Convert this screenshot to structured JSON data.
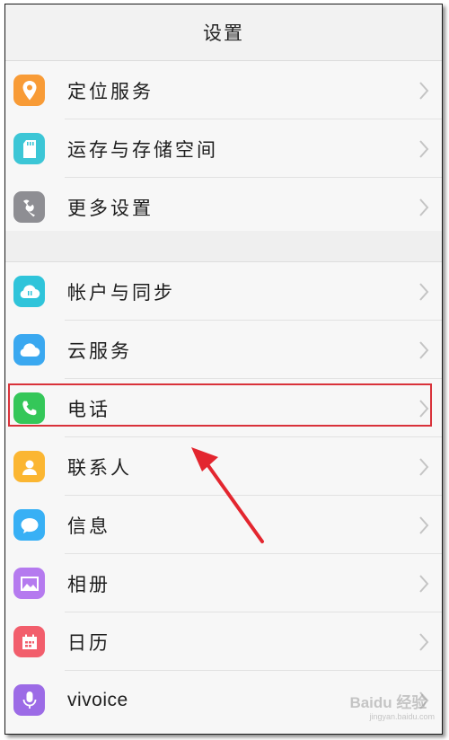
{
  "header": {
    "title": "设置"
  },
  "group_1": [
    {
      "label": "定位服务",
      "icon": "location-pin-icon",
      "color": "#f89b36"
    },
    {
      "label": "运存与存储空间",
      "icon": "sd-card-icon",
      "color": "#3cc6d6"
    },
    {
      "label": "更多设置",
      "icon": "wrench-icon",
      "color": "#8e8e93"
    }
  ],
  "group_2": [
    {
      "label": "帐户与同步",
      "icon": "cloud-sync-icon",
      "color": "#2fc4da"
    },
    {
      "label": "云服务",
      "icon": "cloud-icon",
      "color": "#3aa8f0"
    },
    {
      "label": "电话",
      "icon": "phone-icon",
      "color": "#34c759",
      "highlighted": true
    },
    {
      "label": "联系人",
      "icon": "contact-person-icon",
      "color": "#fbb632"
    },
    {
      "label": "信息",
      "icon": "message-bubble-icon",
      "color": "#38b0f5"
    },
    {
      "label": "相册",
      "icon": "photo-album-icon",
      "color": "#b57aef"
    },
    {
      "label": "日历",
      "icon": "calendar-icon",
      "color": "#f25e6c"
    },
    {
      "label": "vivoice",
      "icon": "microphone-icon",
      "color": "#9c6be6"
    }
  ],
  "annotation": {
    "highlight_color": "#d9323a",
    "arrow_color": "#e3262f"
  },
  "watermark": {
    "brand": "Baidu 经验",
    "url": "jingyan.baidu.com"
  }
}
